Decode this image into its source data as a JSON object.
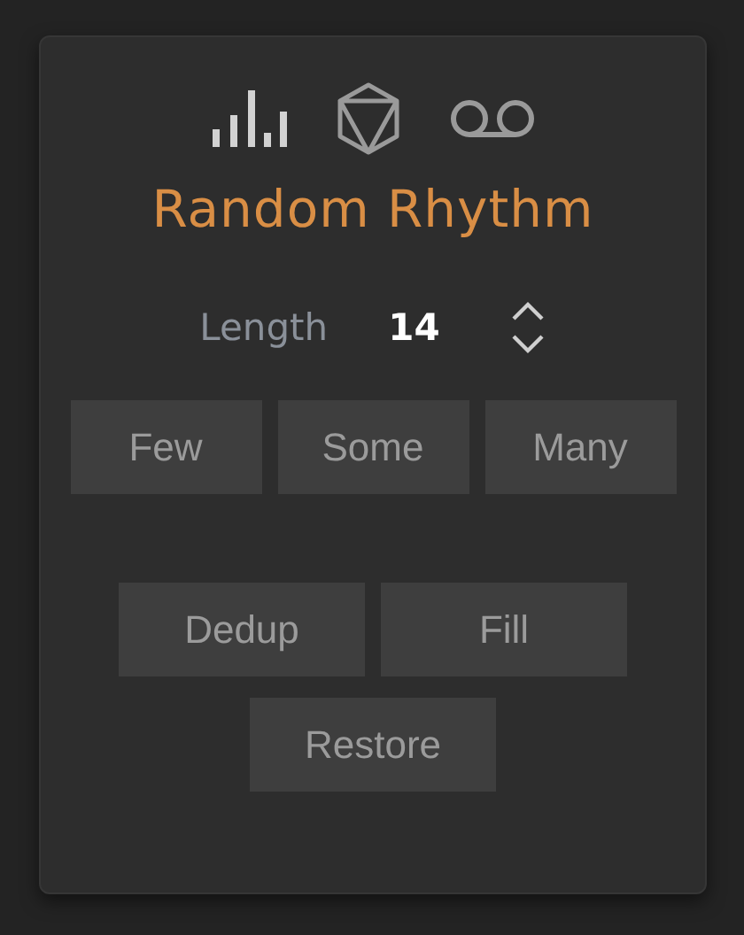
{
  "modes": [
    {
      "kind": "bars",
      "selected": true
    },
    {
      "kind": "polyhedron",
      "selected": false
    },
    {
      "kind": "tape",
      "selected": false
    }
  ],
  "title": "Random Rhythm",
  "length": {
    "label": "Length",
    "value": "14"
  },
  "density_buttons": [
    "Few",
    "Some",
    "Many"
  ],
  "edit_buttons": [
    "Dedup",
    "Fill"
  ],
  "restore_button": "Restore"
}
